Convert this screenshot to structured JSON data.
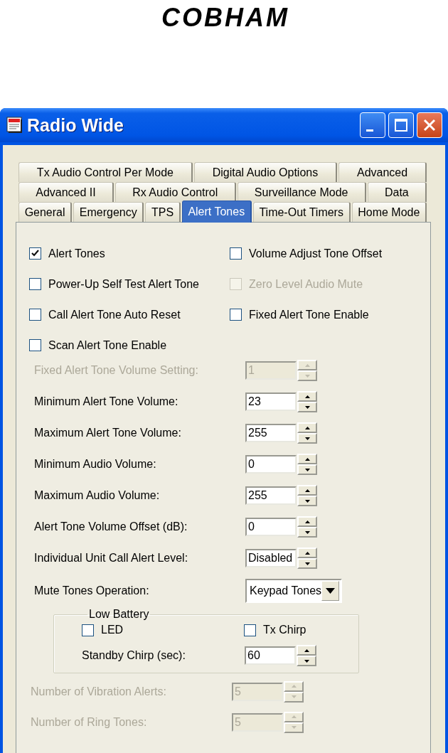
{
  "logo": "COBHAM",
  "window": {
    "title": "Radio Wide"
  },
  "tab_rows": [
    {
      "tabs": [
        {
          "label": "Tx Audio Control Per Mode",
          "selected": false
        },
        {
          "label": "Digital Audio Options",
          "selected": false
        },
        {
          "label": "Advanced",
          "selected": false
        }
      ]
    },
    {
      "tabs": [
        {
          "label": "Advanced II",
          "selected": false
        },
        {
          "label": "Rx Audio Control",
          "selected": false
        },
        {
          "label": "Surveillance Mode",
          "selected": false
        },
        {
          "label": "Data",
          "selected": false
        }
      ]
    },
    {
      "tabs": [
        {
          "label": "General",
          "selected": false
        },
        {
          "label": "Emergency",
          "selected": false
        },
        {
          "label": "TPS",
          "selected": false
        },
        {
          "label": "Alert Tones",
          "selected": true
        },
        {
          "label": "Time-Out Timers",
          "selected": false
        },
        {
          "label": "Home Mode",
          "selected": false
        }
      ]
    }
  ],
  "options": [
    {
      "label": "Alert Tones",
      "checked": true,
      "disabled": false
    },
    {
      "label": "Volume Adjust Tone Offset",
      "checked": false,
      "disabled": false
    },
    {
      "label": "Power-Up Self Test Alert Tone",
      "checked": false,
      "disabled": false
    },
    {
      "label": "Zero Level Audio Mute",
      "checked": false,
      "disabled": true
    },
    {
      "label": "Call Alert Tone Auto Reset",
      "checked": false,
      "disabled": false
    },
    {
      "label": "Fixed Alert Tone Enable",
      "checked": false,
      "disabled": false
    },
    {
      "label": "Scan Alert Tone Enable",
      "checked": false,
      "disabled": false
    }
  ],
  "settings": [
    {
      "kind": "spin",
      "label": "Fixed Alert Tone Volume Setting:",
      "value": "1",
      "disabled": true
    },
    {
      "kind": "spin",
      "label": "Minimum Alert Tone Volume:",
      "value": "23",
      "disabled": false
    },
    {
      "kind": "spin",
      "label": "Maximum Alert Tone Volume:",
      "value": "255",
      "disabled": false
    },
    {
      "kind": "spin",
      "label": "Minimum Audio Volume:",
      "value": "0",
      "disabled": false
    },
    {
      "kind": "spin",
      "label": "Maximum Audio Volume:",
      "value": "255",
      "disabled": false
    },
    {
      "kind": "spin",
      "label": "Alert Tone Volume Offset (dB):",
      "value": "0",
      "disabled": false
    },
    {
      "kind": "spin",
      "label": "Individual Unit Call Alert Level:",
      "value": "Disabled",
      "disabled": false
    },
    {
      "kind": "dropdown",
      "label": "Mute Tones Operation:",
      "value": "Keypad Tones",
      "disabled": false
    }
  ],
  "low_battery": {
    "title": "Low Battery",
    "options": [
      {
        "label": "LED",
        "checked": false,
        "disabled": false
      },
      {
        "label": "Tx Chirp",
        "checked": false,
        "disabled": false
      }
    ],
    "settings": [
      {
        "kind": "spin",
        "label": "Standby Chirp (sec):",
        "value": "60",
        "disabled": false
      }
    ]
  },
  "more_settings": [
    {
      "kind": "spin",
      "label": "Number of Vibration Alerts:",
      "value": "5",
      "disabled": true
    },
    {
      "kind": "spin",
      "label": "Number of Ring Tones:",
      "value": "5",
      "disabled": true
    }
  ]
}
